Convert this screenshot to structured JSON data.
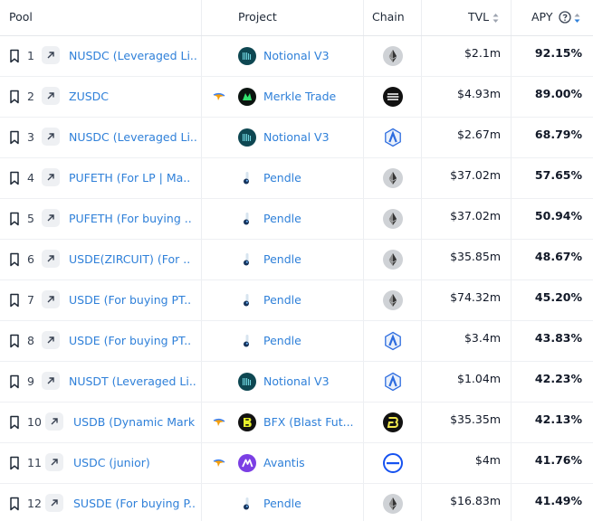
{
  "header": {
    "pool": "Pool",
    "project": "Project",
    "chain": "Chain",
    "tvl": "TVL",
    "apy": "APY"
  },
  "rows": [
    {
      "rank": "1",
      "pool": "NUSDC (Leveraged Li..",
      "project": "Notional V3",
      "project_icon": "notional-icon",
      "chain_icon": "ethereum-icon",
      "has_bird": false,
      "tvl": "$2.1m",
      "apy": "92.15%"
    },
    {
      "rank": "2",
      "pool": "ZUSDC",
      "project": "Merkle Trade",
      "project_icon": "merkle-trade-icon",
      "chain_icon": "aptos-icon",
      "has_bird": true,
      "tvl": "$4.93m",
      "apy": "89.00%"
    },
    {
      "rank": "3",
      "pool": "NUSDC (Leveraged Li..",
      "project": "Notional V3",
      "project_icon": "notional-icon",
      "chain_icon": "arbitrum-icon",
      "has_bird": false,
      "tvl": "$2.67m",
      "apy": "68.79%"
    },
    {
      "rank": "4",
      "pool": "PUFETH (For LP | Ma..",
      "project": "Pendle",
      "project_icon": "pendle-icon",
      "chain_icon": "ethereum-icon",
      "has_bird": false,
      "tvl": "$37.02m",
      "apy": "57.65%"
    },
    {
      "rank": "5",
      "pool": "PUFETH (For buying ..",
      "project": "Pendle",
      "project_icon": "pendle-icon",
      "chain_icon": "ethereum-icon",
      "has_bird": false,
      "tvl": "$37.02m",
      "apy": "50.94%"
    },
    {
      "rank": "6",
      "pool": "USDE(ZIRCUIT) (For ..",
      "project": "Pendle",
      "project_icon": "pendle-icon",
      "chain_icon": "ethereum-icon",
      "has_bird": false,
      "tvl": "$35.85m",
      "apy": "48.67%"
    },
    {
      "rank": "7",
      "pool": "USDE (For buying PT..",
      "project": "Pendle",
      "project_icon": "pendle-icon",
      "chain_icon": "ethereum-icon",
      "has_bird": false,
      "tvl": "$74.32m",
      "apy": "45.20%"
    },
    {
      "rank": "8",
      "pool": "USDE (For buying PT..",
      "project": "Pendle",
      "project_icon": "pendle-icon",
      "chain_icon": "arbitrum-icon",
      "has_bird": false,
      "tvl": "$3.4m",
      "apy": "43.83%"
    },
    {
      "rank": "9",
      "pool": "NUSDT (Leveraged Li..",
      "project": "Notional V3",
      "project_icon": "notional-icon",
      "chain_icon": "arbitrum-icon",
      "has_bird": false,
      "tvl": "$1.04m",
      "apy": "42.23%"
    },
    {
      "rank": "10",
      "pool": "USDB (Dynamic Mark",
      "project": "BFX (Blast Fut...",
      "project_icon": "bfx-icon",
      "chain_icon": "blast-icon",
      "has_bird": true,
      "tvl": "$35.35m",
      "apy": "42.13%"
    },
    {
      "rank": "11",
      "pool": "USDC (junior)",
      "project": "Avantis",
      "project_icon": "avantis-icon",
      "chain_icon": "base-icon",
      "has_bird": true,
      "tvl": "$4m",
      "apy": "41.76%"
    },
    {
      "rank": "12",
      "pool": "SUSDE (For buying P..",
      "project": "Pendle",
      "project_icon": "pendle-icon",
      "chain_icon": "ethereum-icon",
      "has_bird": false,
      "tvl": "$16.83m",
      "apy": "41.49%"
    }
  ],
  "colors": {
    "link": "#2f80d9",
    "sort_active": "#2f80d9",
    "notional": "#0e4752",
    "merkle": "#0b1410",
    "bfx": "#111111",
    "avantis": "#7b3fe4",
    "arbitrum": "#2d6cdf",
    "base": "#1652f0"
  }
}
